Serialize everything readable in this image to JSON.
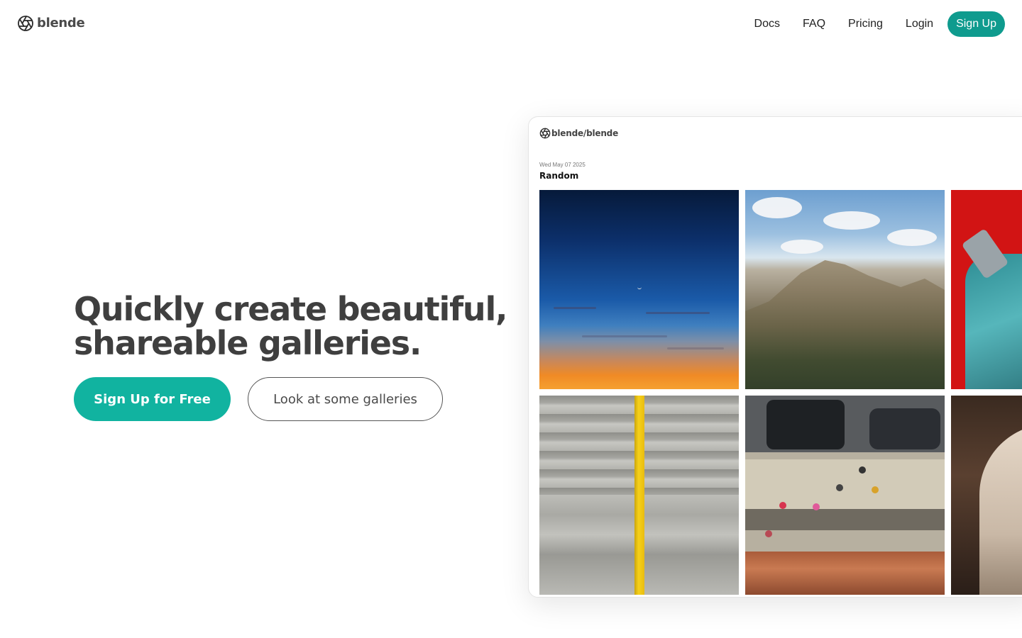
{
  "header": {
    "logo_text": "blende",
    "nav": {
      "docs": "Docs",
      "faq": "FAQ",
      "pricing": "Pricing",
      "login": "Login",
      "signup": "Sign Up"
    }
  },
  "hero": {
    "title_line1": "Quickly create beautiful,",
    "title_line2": "shareable galleries.",
    "primary_cta": "Sign Up for Free",
    "secondary_cta": "Look at some galleries"
  },
  "preview": {
    "logo_text": "blende/blende",
    "date": "Wed May 07 2025",
    "gallery_title": "Random"
  },
  "colors": {
    "brand": "#11b3a0",
    "nav_signup": "#0f9b8e",
    "heading": "#3f3f3f"
  },
  "icons": {
    "logo": "aperture-icon"
  }
}
